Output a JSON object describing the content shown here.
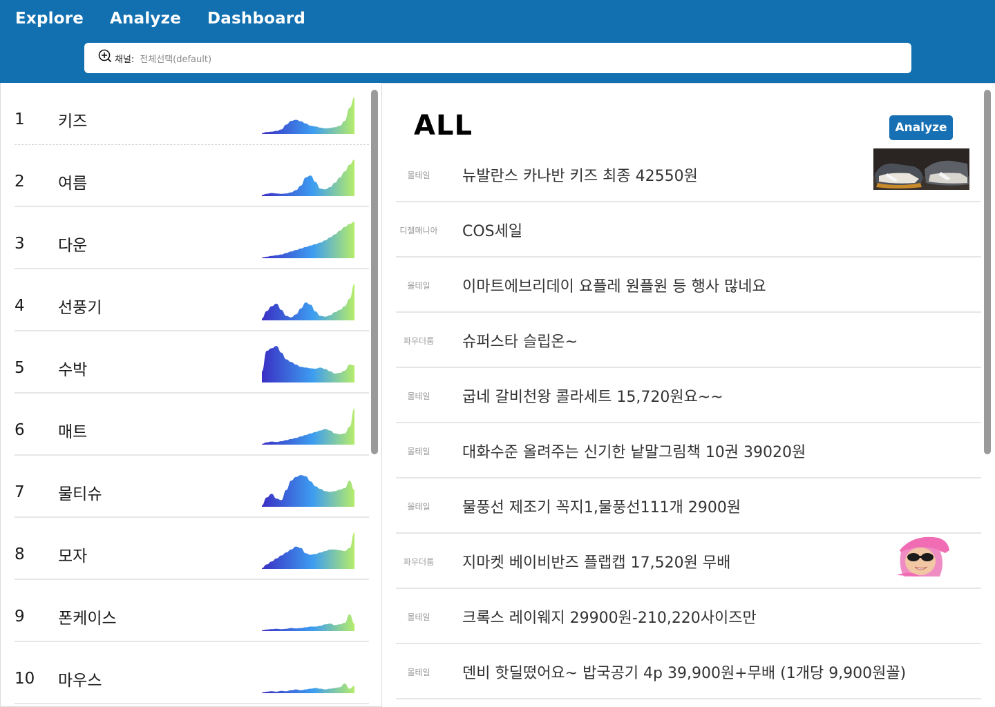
{
  "nav": {
    "explore": "Explore",
    "analyze": "Analyze",
    "dashboard": "Dashboard"
  },
  "search": {
    "label": "채널:",
    "value": "전체선택(default)",
    "icon": "zoom-in-icon"
  },
  "colors": {
    "header": "#1270b0",
    "button": "#1670b3",
    "sparkline_start": "#3a2fc4",
    "sparkline_mid": "#3d9df0",
    "sparkline_end": "#b6ec6a"
  },
  "keywords": [
    {
      "rank": "1",
      "keyword": "키즈",
      "trend": [
        0.02,
        0.05,
        0.06,
        0.08,
        0.12,
        0.25,
        0.35,
        0.38,
        0.34,
        0.28,
        0.22,
        0.2,
        0.17,
        0.15,
        0.16,
        0.18,
        0.22,
        0.35,
        0.7,
        0.98
      ]
    },
    {
      "rank": "2",
      "keyword": "여름",
      "trend": [
        0.03,
        0.06,
        0.08,
        0.07,
        0.06,
        0.07,
        0.1,
        0.16,
        0.28,
        0.5,
        0.55,
        0.38,
        0.2,
        0.18,
        0.24,
        0.36,
        0.5,
        0.66,
        0.84,
        0.98
      ]
    },
    {
      "rank": "3",
      "keyword": "다운",
      "trend": [
        0.02,
        0.04,
        0.06,
        0.08,
        0.1,
        0.14,
        0.18,
        0.22,
        0.26,
        0.3,
        0.34,
        0.38,
        0.42,
        0.48,
        0.56,
        0.64,
        0.74,
        0.84,
        0.92,
        0.98
      ]
    },
    {
      "rank": "4",
      "keyword": "선풍기",
      "trend": [
        0.05,
        0.25,
        0.38,
        0.45,
        0.28,
        0.12,
        0.08,
        0.16,
        0.32,
        0.48,
        0.42,
        0.24,
        0.12,
        0.1,
        0.14,
        0.22,
        0.28,
        0.38,
        0.58,
        0.98
      ]
    },
    {
      "rank": "5",
      "keyword": "수박",
      "trend": [
        0.3,
        0.85,
        0.92,
        0.98,
        0.8,
        0.62,
        0.55,
        0.48,
        0.42,
        0.4,
        0.38,
        0.37,
        0.4,
        0.36,
        0.3,
        0.24,
        0.26,
        0.32,
        0.48,
        0.46
      ]
    },
    {
      "rank": "6",
      "keyword": "매트",
      "trend": [
        0.02,
        0.06,
        0.08,
        0.07,
        0.09,
        0.12,
        0.15,
        0.18,
        0.22,
        0.26,
        0.3,
        0.34,
        0.38,
        0.42,
        0.38,
        0.3,
        0.28,
        0.3,
        0.48,
        0.98
      ]
    },
    {
      "rank": "7",
      "keyword": "물티슈",
      "trend": [
        0.04,
        0.25,
        0.35,
        0.22,
        0.18,
        0.45,
        0.7,
        0.8,
        0.85,
        0.82,
        0.68,
        0.55,
        0.48,
        0.42,
        0.4,
        0.42,
        0.46,
        0.5,
        0.7,
        0.45
      ]
    },
    {
      "rank": "8",
      "keyword": "모자",
      "trend": [
        0.02,
        0.12,
        0.2,
        0.28,
        0.36,
        0.44,
        0.52,
        0.6,
        0.56,
        0.42,
        0.38,
        0.4,
        0.44,
        0.48,
        0.52,
        0.52,
        0.5,
        0.48,
        0.56,
        0.98
      ]
    },
    {
      "rank": "9",
      "keyword": "폰케이스",
      "trend": [
        0.02,
        0.04,
        0.05,
        0.06,
        0.05,
        0.06,
        0.08,
        0.07,
        0.08,
        0.1,
        0.12,
        0.12,
        0.14,
        0.18,
        0.2,
        0.16,
        0.18,
        0.22,
        0.45,
        0.2
      ]
    },
    {
      "rank": "10",
      "keyword": "마우스",
      "trend": [
        0.02,
        0.04,
        0.05,
        0.04,
        0.06,
        0.05,
        0.08,
        0.1,
        0.08,
        0.1,
        0.12,
        0.14,
        0.12,
        0.1,
        0.12,
        0.14,
        0.16,
        0.26,
        0.12,
        0.2
      ]
    }
  ],
  "detail": {
    "category_title": "ALL",
    "analyze_button": "Analyze",
    "posts": [
      {
        "source": "몰테일",
        "title": "뉴발란스 카나반 키즈 최종 42550원",
        "thumbnail": "sneaker-photo"
      },
      {
        "source": "디젤매니아",
        "title": "COS세일",
        "thumbnail": ""
      },
      {
        "source": "몰테일",
        "title": "이마트에브리데이 요플레 원플원 등 행사 많네요",
        "thumbnail": ""
      },
      {
        "source": "파우더룸",
        "title": "슈퍼스타 슬립온~",
        "thumbnail": ""
      },
      {
        "source": "몰테일",
        "title": "굽네 갈비천왕 콜라세트 15,720원요~~",
        "thumbnail": ""
      },
      {
        "source": "몰테일",
        "title": "대화수준 올려주는 신기한 낱말그림책 10권 39020원",
        "thumbnail": ""
      },
      {
        "source": "몰테일",
        "title": "물풍선 제조기 꼭지1,물풍선111개 2900원",
        "thumbnail": ""
      },
      {
        "source": "파우더룸",
        "title": "지마켓 베이비반즈 플랩캡 17,520원 무배",
        "thumbnail": "kid-sunglasses-photo"
      },
      {
        "source": "몰테일",
        "title": "크록스 레이웨지 29900원-210,220사이즈만",
        "thumbnail": ""
      },
      {
        "source": "몰테일",
        "title": "덴비 핫딜떴어요~ 밥국공기 4p 39,900원+무배 (1개당 9,900원꼴)",
        "thumbnail": ""
      }
    ]
  }
}
